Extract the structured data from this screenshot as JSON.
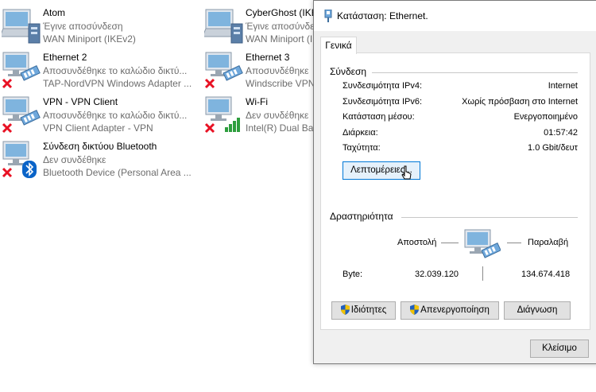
{
  "adapters": [
    {
      "name": "Atom",
      "status": "Έγινε αποσύνδεση",
      "device": "WAN Miniport (IKEv2)",
      "icon": "computer-adapter-icon",
      "overlay": "none"
    },
    {
      "name": "CyberGhost (IKE",
      "status": "Έγινε αποσύνδεση",
      "device": "WAN Miniport (IKE",
      "icon": "computer-adapter-icon",
      "overlay": "none"
    },
    {
      "name": "Ethernet 2",
      "status": "Αποσυνδέθηκε το καλώδιο δικτύ...",
      "device": "TAP-NordVPN Windows Adapter ...",
      "icon": "ethernet-adapter-icon",
      "overlay": "red-x-icon"
    },
    {
      "name": "Ethernet 3",
      "status": "Αποσυνδέθηκε",
      "device": "Windscribe VPN",
      "icon": "ethernet-adapter-icon",
      "overlay": "red-x-icon"
    },
    {
      "name": "VPN - VPN Client",
      "status": "Αποσυνδέθηκε το καλώδιο δικτύ...",
      "device": "VPN Client Adapter - VPN",
      "icon": "ethernet-adapter-icon",
      "overlay": "red-x-icon"
    },
    {
      "name": "Wi-Fi",
      "status": "Δεν συνδέθηκε",
      "device": "Intel(R) Dual Ban",
      "icon": "wifi-adapter-icon",
      "overlay": "red-x-icon"
    },
    {
      "name": "Σύνδεση δικτύου Bluetooth",
      "status": "Δεν συνδέθηκε",
      "device": "Bluetooth Device (Personal Area ...",
      "icon": "bluetooth-adapter-icon",
      "overlay": "red-x-icon"
    }
  ],
  "dialog": {
    "title": "Κατάσταση: Ethernet.",
    "tab": "Γενικά",
    "connection": {
      "heading": "Σύνδεση",
      "rows": [
        {
          "label": "Συνδεσιμότητα IPv4:",
          "value": "Internet"
        },
        {
          "label": "Συνδεσιμότητα IPv6:",
          "value": "Χωρίς πρόσβαση στο Internet"
        },
        {
          "label": "Κατάσταση μέσου:",
          "value": "Ενεργοποιημένο"
        },
        {
          "label": "Διάρκεια:",
          "value": "01:57:42"
        },
        {
          "label": "Ταχύτητα:",
          "value": "1.0 Gbit/δευτ"
        }
      ],
      "details_button": "Λεπτομέρειες..."
    },
    "activity": {
      "heading": "Δραστηριότητα",
      "sent_label": "Αποστολή",
      "received_label": "Παραλαβή",
      "bytes_label": "Byte:",
      "bytes_sent": "32.039.120",
      "bytes_received": "134.674.418"
    },
    "buttons": {
      "properties": "Ιδιότητες",
      "disable": "Απενεργοποίηση",
      "diagnose": "Διάγνωση",
      "close": "Κλείσιμο"
    }
  },
  "colors": {
    "focus_border": "#0078d7",
    "disabled_x": "#e81123"
  }
}
